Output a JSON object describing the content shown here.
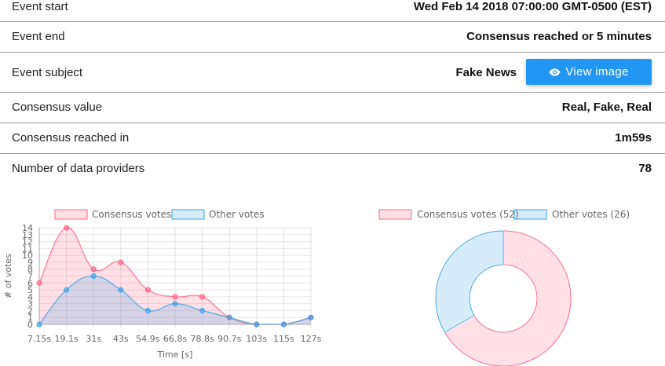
{
  "event": {
    "start_label": "Event start",
    "start_value": "Wed Feb 14 2018 07:00:00 GMT-0500 (EST)",
    "end_label": "Event end",
    "end_value": "Consensus reached or 5 minutes",
    "subject_label": "Event subject",
    "subject_value": "Fake News",
    "view_image_label": "View image",
    "consensus_value_label": "Consensus value",
    "consensus_value": "Real, Fake, Real",
    "reached_in_label": "Consensus reached in",
    "reached_in_value": "1m59s",
    "providers_label": "Number of data providers",
    "providers_value": "78"
  },
  "colors": {
    "button": "#2196f3",
    "consensus_fill": "rgba(255,99,132,0.2)",
    "consensus_border": "#ff6384",
    "other_fill": "rgba(54,162,235,0.2)",
    "other_border": "#36a2eb"
  },
  "chart_data": [
    {
      "type": "line",
      "xlabel": "Time [s]",
      "ylabel": "# of votes",
      "categories": [
        "7.15s",
        "19.1s",
        "31s",
        "43s",
        "54.9s",
        "66.8s",
        "78.8s",
        "90.7s",
        "103s",
        "115s",
        "127s"
      ],
      "ylim": [
        0,
        14
      ],
      "yticks": [
        0,
        1,
        2,
        3,
        4,
        5,
        6,
        7,
        8,
        9,
        10,
        11,
        12,
        13,
        14
      ],
      "grid": true,
      "legend": "top",
      "series": [
        {
          "name": "Consensus votes",
          "values": [
            6,
            14,
            8,
            9,
            5,
            4,
            4,
            1,
            0,
            0,
            1
          ]
        },
        {
          "name": "Other votes",
          "values": [
            0,
            5,
            7,
            5,
            2,
            3,
            2,
            1,
            0,
            0,
            1
          ]
        }
      ]
    },
    {
      "type": "pie",
      "legend": "top",
      "series": [
        {
          "name": "Consensus votes (52)",
          "value": 52
        },
        {
          "name": "Other votes (26)",
          "value": 26
        }
      ]
    }
  ]
}
